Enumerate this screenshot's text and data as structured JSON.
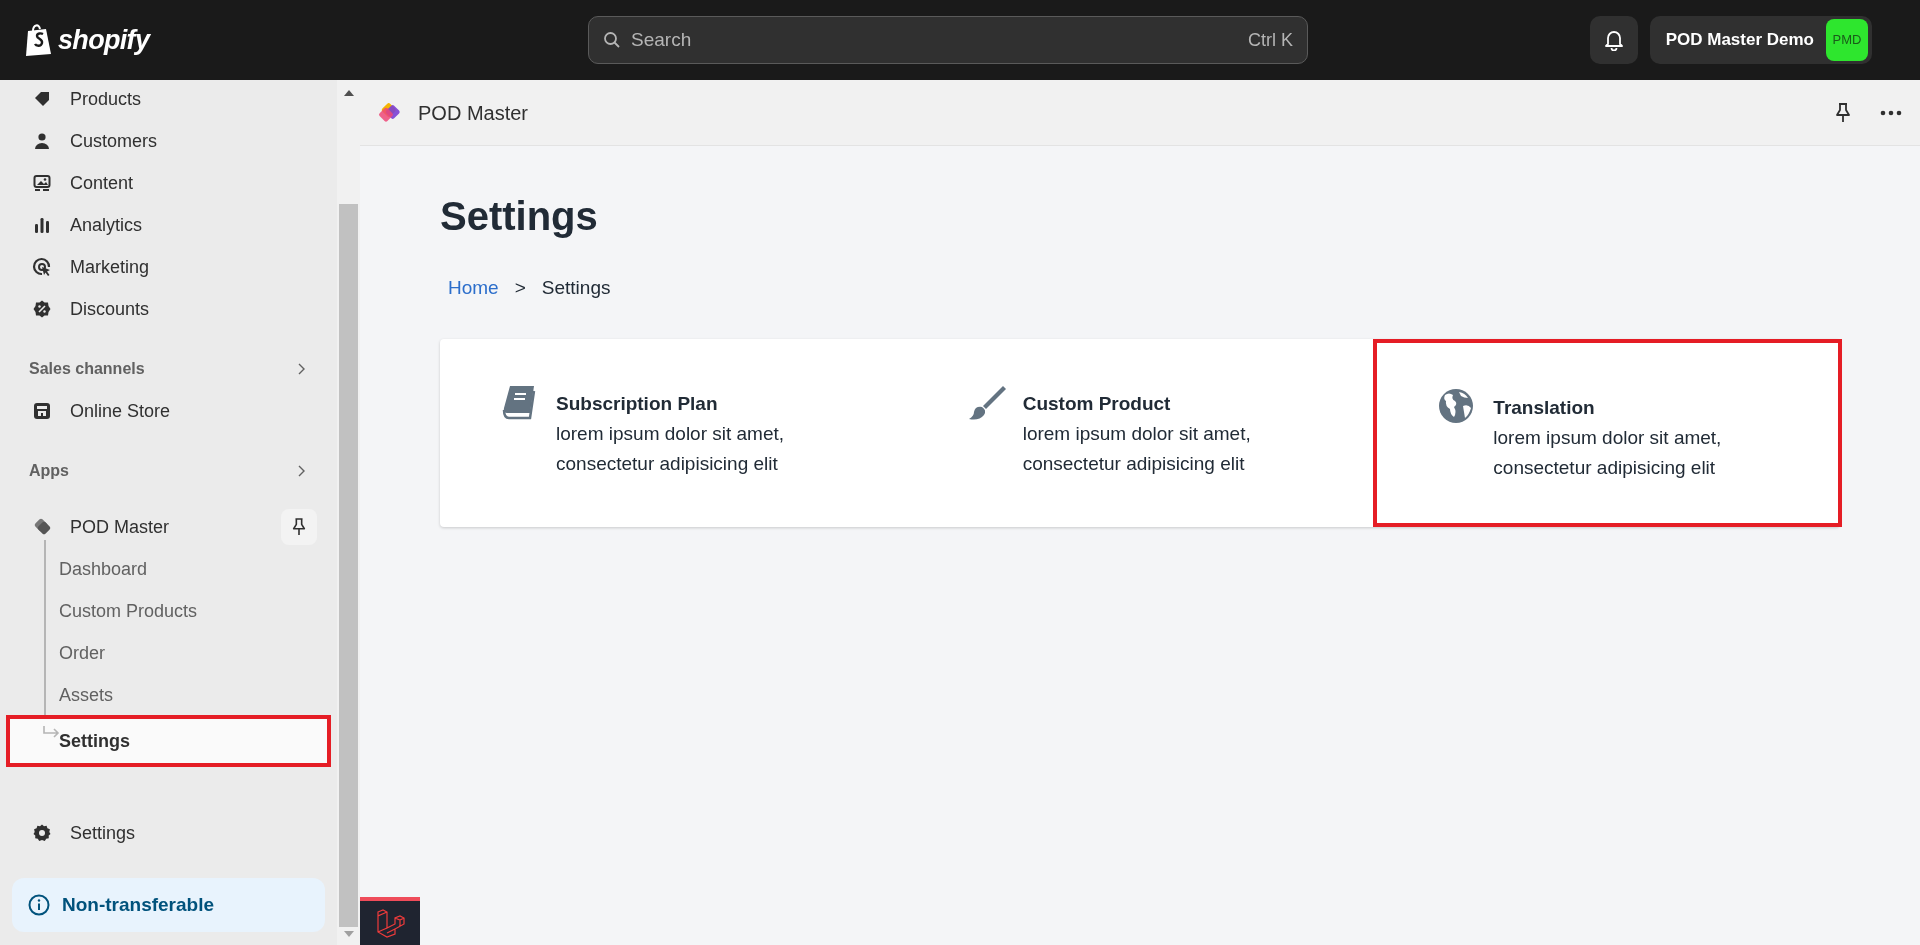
{
  "top_bar": {
    "logo_text": "shopify",
    "search": {
      "placeholder": "Search",
      "shortcut": "Ctrl K"
    },
    "store": {
      "name": "POD Master Demo",
      "initials": "PMD"
    }
  },
  "sidebar": {
    "items": [
      {
        "label": "Products"
      },
      {
        "label": "Customers"
      },
      {
        "label": "Content"
      },
      {
        "label": "Analytics"
      },
      {
        "label": "Marketing"
      },
      {
        "label": "Discounts"
      }
    ],
    "sales_channels": {
      "title": "Sales channels",
      "items": [
        {
          "label": "Online Store"
        }
      ]
    },
    "apps": {
      "title": "Apps",
      "app": {
        "label": "POD Master",
        "children": [
          {
            "label": "Dashboard",
            "selected": false,
            "highlighted": false
          },
          {
            "label": "Custom Products",
            "selected": false,
            "highlighted": false
          },
          {
            "label": "Order",
            "selected": false,
            "highlighted": false
          },
          {
            "label": "Assets",
            "selected": false,
            "highlighted": false
          },
          {
            "label": "Settings",
            "selected": true,
            "highlighted": true
          }
        ]
      }
    },
    "settings": {
      "label": "Settings"
    },
    "notice": {
      "label": "Non-transferable"
    }
  },
  "app_header": {
    "title": "POD Master"
  },
  "page": {
    "title": "Settings",
    "breadcrumb": [
      {
        "label": "Home",
        "link": true
      },
      {
        "label": "Settings",
        "link": false
      }
    ],
    "separator": ">"
  },
  "cards": [
    {
      "title": "Subscription Plan",
      "description": "lorem ipsum dolor sit amet, consectetur adipisicing elit",
      "highlighted": false
    },
    {
      "title": "Custom Product",
      "description": "lorem ipsum dolor sit amet, consectetur adipisicing elit",
      "highlighted": false
    },
    {
      "title": "Translation",
      "description": "lorem ipsum dolor sit amet, consectetur adipisicing elit",
      "highlighted": true
    }
  ]
}
